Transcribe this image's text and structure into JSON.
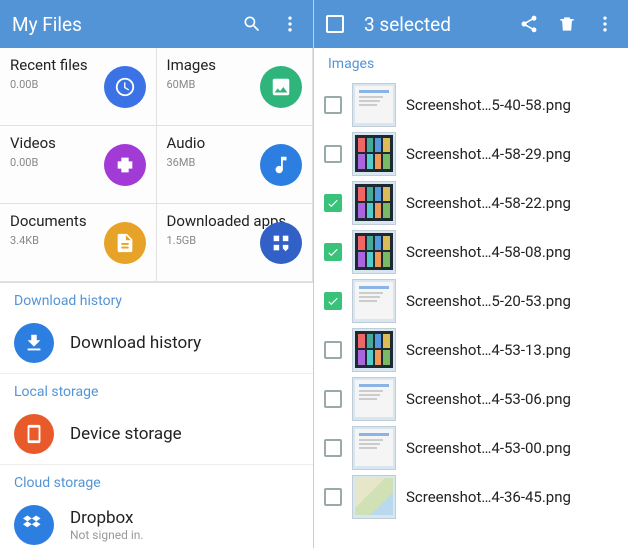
{
  "left": {
    "title": "My Files",
    "grid": [
      {
        "label": "Recent files",
        "size": "0.00B",
        "color": "#3b73e6",
        "icon": "clock"
      },
      {
        "label": "Images",
        "size": "60MB",
        "color": "#2fb57b",
        "icon": "image"
      },
      {
        "label": "Videos",
        "size": "0.00B",
        "color": "#a23ad6",
        "icon": "film"
      },
      {
        "label": "Audio",
        "size": "36MB",
        "color": "#2c7fe0",
        "icon": "note"
      },
      {
        "label": "Documents",
        "size": "3.4KB",
        "color": "#e7a228",
        "icon": "doc"
      },
      {
        "label": "Downloaded apps",
        "size": "1.5GB",
        "color": "#3160c7",
        "icon": "apps"
      }
    ],
    "sections": {
      "download_history": {
        "header": "Download history",
        "item": "Download history",
        "color": "#2c7fe0",
        "icon": "download"
      },
      "local_storage": {
        "header": "Local storage",
        "item": "Device storage",
        "color": "#e85a2a",
        "icon": "device"
      },
      "cloud_storage": {
        "header": "Cloud storage",
        "item": "Dropbox",
        "sub": "Not signed in.",
        "color": "#2c7fe0",
        "icon": "dropbox"
      }
    }
  },
  "right": {
    "selected_text": "3 selected",
    "section": "Images",
    "files": [
      {
        "name": "Screenshot…5-40-58.png",
        "checked": false,
        "thumb": "light"
      },
      {
        "name": "Screenshot…4-58-29.png",
        "checked": false,
        "thumb": "dark"
      },
      {
        "name": "Screenshot…4-58-22.png",
        "checked": true,
        "thumb": "dark"
      },
      {
        "name": "Screenshot…4-58-08.png",
        "checked": true,
        "thumb": "dark"
      },
      {
        "name": "Screenshot…5-20-53.png",
        "checked": true,
        "thumb": "light"
      },
      {
        "name": "Screenshot…4-53-13.png",
        "checked": false,
        "thumb": "dark"
      },
      {
        "name": "Screenshot…4-53-06.png",
        "checked": false,
        "thumb": "light"
      },
      {
        "name": "Screenshot…4-53-00.png",
        "checked": false,
        "thumb": "light"
      },
      {
        "name": "Screenshot…4-36-45.png",
        "checked": false,
        "thumb": "map"
      }
    ]
  }
}
